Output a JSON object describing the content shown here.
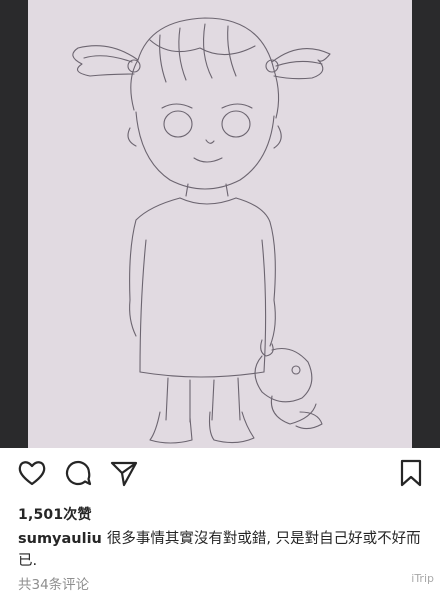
{
  "post": {
    "image_alt": "pencil sketch of a little girl with pigtails holding a toy",
    "likes_text": "1,501次赞",
    "caption": {
      "username": "sumyauliu",
      "text": "很多事情其實沒有對或錯, 只是對自己好或不好而已."
    },
    "comments_text": "共34条评论"
  },
  "actions": {
    "like_icon": "heart-icon",
    "comment_icon": "comment-icon",
    "share_icon": "send-icon",
    "save_icon": "bookmark-icon"
  },
  "watermark": "iTrip"
}
